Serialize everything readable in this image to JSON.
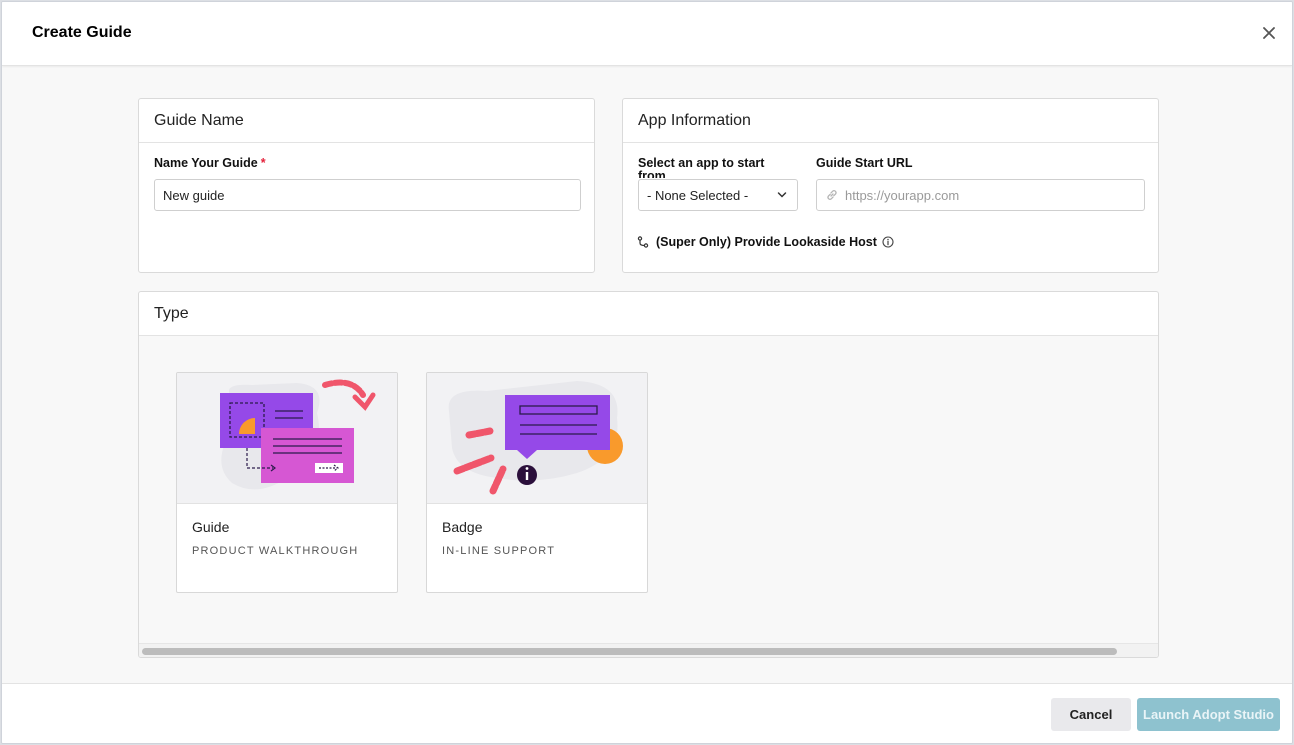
{
  "modal": {
    "title": "Create Guide",
    "close_icon": "close-icon"
  },
  "guide_name": {
    "heading": "Guide Name",
    "field_label": "Name Your Guide",
    "required_mark": "*",
    "value": "New guide"
  },
  "app_info": {
    "heading": "App Information",
    "select_label": "Select an app to start from",
    "select_value": "- None Selected -",
    "url_label": "Guide Start URL",
    "url_placeholder": "https://yourapp.com",
    "url_value": "",
    "lookaside_label": "(Super Only) Provide Lookaside Host",
    "lookaside_icon": "branch-icon",
    "info_icon": "info-icon"
  },
  "type": {
    "heading": "Type",
    "options": [
      {
        "title": "Guide",
        "subtitle": "PRODUCT WALKTHROUGH"
      },
      {
        "title": "Badge",
        "subtitle": "IN-LINE SUPPORT"
      }
    ]
  },
  "footer": {
    "cancel_label": "Cancel",
    "launch_label": "Launch Adopt Studio"
  },
  "colors": {
    "purple": "#9549e8",
    "magenta": "#d657d3",
    "orange": "#f99a2c",
    "coral": "#f0566b",
    "launch_button": "#8ec2cf",
    "required": "#e4223b"
  }
}
